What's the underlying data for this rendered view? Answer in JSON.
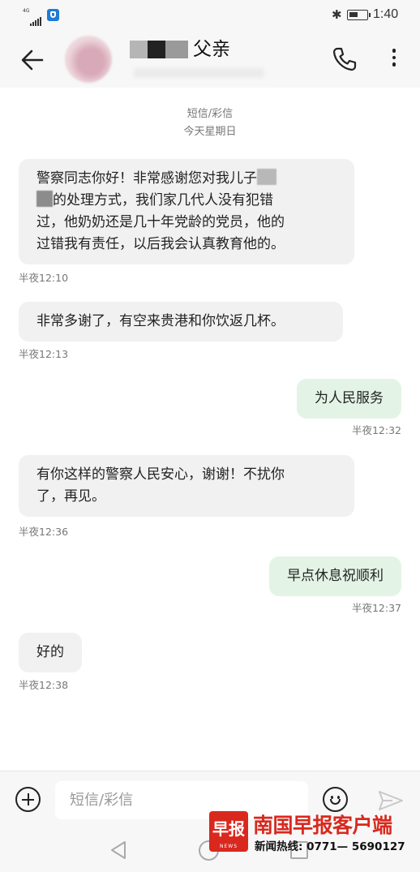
{
  "status_bar": {
    "network": "4G",
    "time": "1:40"
  },
  "header": {
    "contact_name": "父亲",
    "avatar_icon": "contact-avatar",
    "back_icon": "arrow-left-icon",
    "call_icon": "phone-icon",
    "more_icon": "more-vertical-icon"
  },
  "conversation": {
    "channel_label": "短信/彩信",
    "date_label": "今天星期日",
    "messages": [
      {
        "direction": "incoming",
        "line1_text": "警察同志你好！非常感谢您对我儿子",
        "line2_text": "的处理方式，我们家几代人没有犯错",
        "line3": "过，他奶奶还是几十年党龄的党员，他的",
        "line4": "过错我有责任，以后我会认真教育他的。",
        "time": "半夜12:10"
      },
      {
        "direction": "incoming",
        "text": "非常多谢了，有空来贵港和你饮返几杯。",
        "time": "半夜12:13"
      },
      {
        "direction": "outgoing",
        "text": "为人民服务",
        "time": "半夜12:32"
      },
      {
        "direction": "incoming",
        "line1": "有你这样的警察人民安心，谢谢！不扰你",
        "line2": "了，再见。",
        "time": "半夜12:36"
      },
      {
        "direction": "outgoing",
        "text": "早点休息祝顺利",
        "time": "半夜12:37"
      },
      {
        "direction": "incoming",
        "text": "好的",
        "time": "半夜12:38"
      }
    ]
  },
  "composer": {
    "placeholder": "短信/彩信",
    "add_icon": "plus-circle-icon",
    "emoji_icon": "smiley-icon",
    "send_icon": "send-icon"
  },
  "watermark": {
    "logo_text": "早报",
    "logo_sub": "NEWS",
    "name": "南国早报客户端",
    "hotline": "新闻热线: 0771— 5690127",
    "brand_color": "#d9281e"
  },
  "colors": {
    "incoming_bubble": "#f1f1f1",
    "outgoing_bubble": "#e3f4e6",
    "bar_background": "#f7f7f7"
  }
}
